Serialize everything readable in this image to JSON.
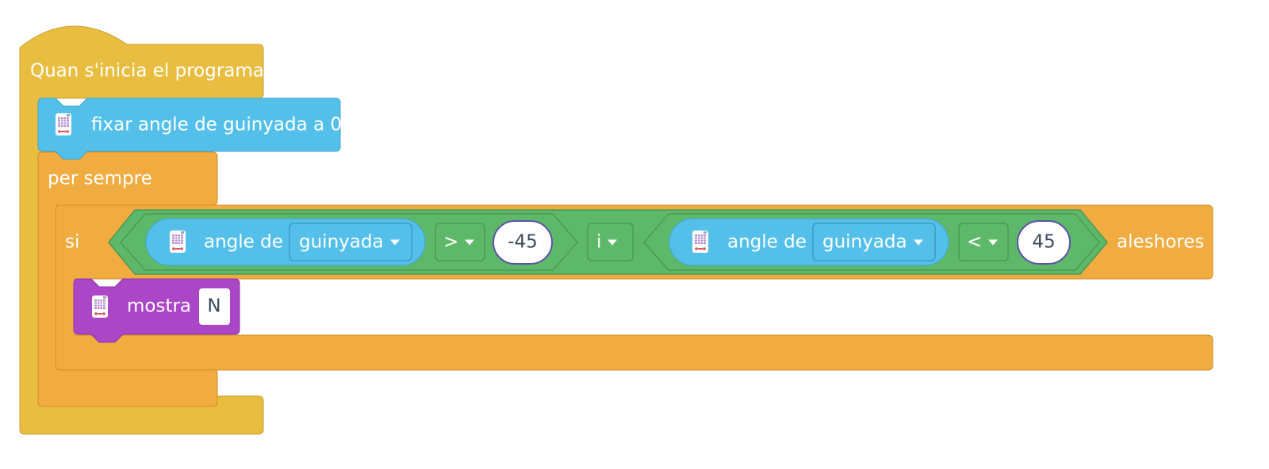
{
  "script": {
    "hat_label": "Quan s'inicia el programa",
    "set_yaw_label": "fixar angle de guinyada a",
    "set_yaw_value": "0",
    "forever_label": "per sempre",
    "if_label": "si",
    "then_label": "aleshores",
    "and_label": "i",
    "left_condition": {
      "reporter_label": "angle de",
      "axis_option": "guinyada",
      "operator": ">",
      "value": "-45"
    },
    "right_condition": {
      "reporter_label": "angle de",
      "axis_option": "guinyada",
      "operator": "<",
      "value": "45"
    },
    "show_label": "mostra",
    "show_value": "N"
  },
  "colors": {
    "events": "#e9bd40",
    "control": "#f0ac40",
    "sensing": "#54c0ea",
    "operators": "#5eb86a",
    "looks": "#ab47c7",
    "text_dark": "#3b4a5a"
  },
  "icons": [
    "microbit-icon"
  ]
}
